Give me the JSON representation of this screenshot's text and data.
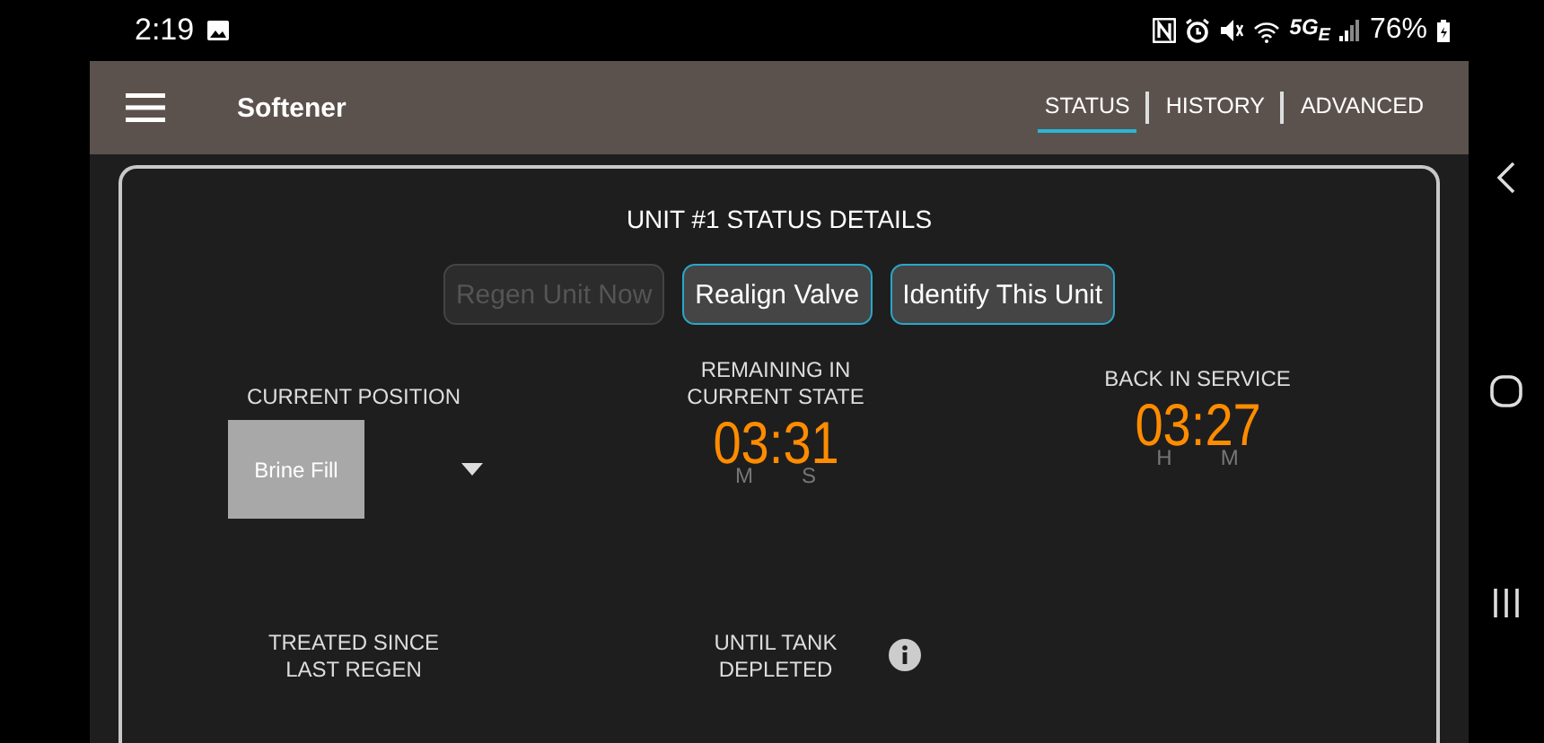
{
  "status_bar": {
    "time": "2:19",
    "network": "5G$_{E}$",
    "battery": "76%"
  },
  "app_bar": {
    "title": "Softener"
  },
  "tabs": [
    {
      "label": "STATUS",
      "selected": true
    },
    {
      "label": "HISTORY",
      "selected": false
    },
    {
      "label": "ADVANCED",
      "selected": false
    }
  ],
  "card": {
    "title": "UNIT #1 STATUS DETAILS",
    "buttons": [
      {
        "label": "Regen Unit Now",
        "disabled": true
      },
      {
        "label": "Realign Valve",
        "disabled": false
      },
      {
        "label": "Identify This Unit",
        "disabled": false
      }
    ],
    "current_position": {
      "label": "CURRENT POSITION",
      "value": "Brine Fill"
    },
    "timers": [
      {
        "label": "REMAINING IN CURRENT STATE",
        "value": "03:31",
        "units": [
          "M",
          "S"
        ]
      },
      {
        "label": "BACK IN SERVICE",
        "value": "03:27",
        "units": [
          "H",
          "M"
        ]
      }
    ],
    "bottom_labels": [
      {
        "label": "TREATED SINCE LAST REGEN",
        "info": false
      },
      {
        "label": "UNTIL TANK DEPLETED",
        "info": true
      }
    ]
  }
}
